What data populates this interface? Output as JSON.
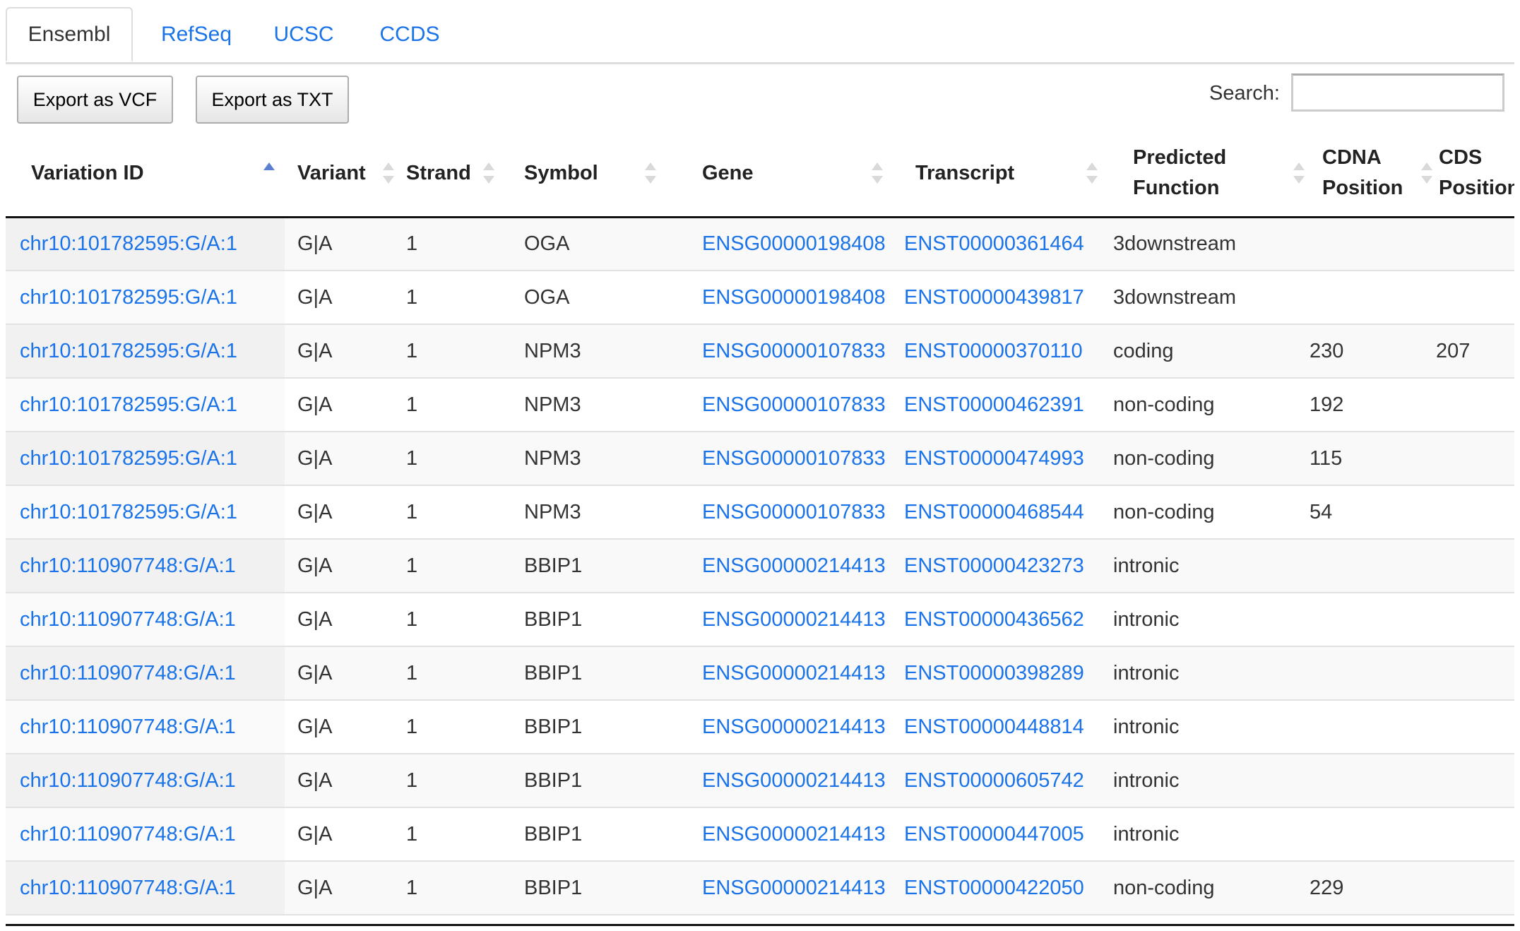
{
  "tabs": [
    {
      "label": "Ensembl",
      "active": true
    },
    {
      "label": "RefSeq",
      "active": false
    },
    {
      "label": "UCSC",
      "active": false
    },
    {
      "label": "CCDS",
      "active": false
    }
  ],
  "toolbar": {
    "export_vcf_label": "Export as VCF",
    "export_txt_label": "Export as TXT",
    "search_label": "Search:",
    "search_value": ""
  },
  "table": {
    "columns": [
      {
        "label": "Variation ID",
        "sort": "asc"
      },
      {
        "label": "Variant",
        "sort": "none"
      },
      {
        "label": "Strand",
        "sort": "none"
      },
      {
        "label": "Symbol",
        "sort": "none"
      },
      {
        "label": "Gene",
        "sort": "none"
      },
      {
        "label": "Transcript",
        "sort": "none"
      },
      {
        "label": "Predicted Function",
        "sort": "none"
      },
      {
        "label": "CDNA Position",
        "sort": "none"
      },
      {
        "label": "CDS Position",
        "sort": "none"
      }
    ],
    "rows": [
      {
        "variation_id": "chr10:101782595:G/A:1",
        "variant": "G|A",
        "strand": "1",
        "symbol": "OGA",
        "gene": "ENSG00000198408",
        "transcript": "ENST00000361464",
        "function": "3downstream",
        "cdna": "",
        "cds": ""
      },
      {
        "variation_id": "chr10:101782595:G/A:1",
        "variant": "G|A",
        "strand": "1",
        "symbol": "OGA",
        "gene": "ENSG00000198408",
        "transcript": "ENST00000439817",
        "function": "3downstream",
        "cdna": "",
        "cds": ""
      },
      {
        "variation_id": "chr10:101782595:G/A:1",
        "variant": "G|A",
        "strand": "1",
        "symbol": "NPM3",
        "gene": "ENSG00000107833",
        "transcript": "ENST00000370110",
        "function": "coding",
        "cdna": "230",
        "cds": "207"
      },
      {
        "variation_id": "chr10:101782595:G/A:1",
        "variant": "G|A",
        "strand": "1",
        "symbol": "NPM3",
        "gene": "ENSG00000107833",
        "transcript": "ENST00000462391",
        "function": "non-coding",
        "cdna": "192",
        "cds": ""
      },
      {
        "variation_id": "chr10:101782595:G/A:1",
        "variant": "G|A",
        "strand": "1",
        "symbol": "NPM3",
        "gene": "ENSG00000107833",
        "transcript": "ENST00000474993",
        "function": "non-coding",
        "cdna": "115",
        "cds": ""
      },
      {
        "variation_id": "chr10:101782595:G/A:1",
        "variant": "G|A",
        "strand": "1",
        "symbol": "NPM3",
        "gene": "ENSG00000107833",
        "transcript": "ENST00000468544",
        "function": "non-coding",
        "cdna": "54",
        "cds": ""
      },
      {
        "variation_id": "chr10:110907748:G/A:1",
        "variant": "G|A",
        "strand": "1",
        "symbol": "BBIP1",
        "gene": "ENSG00000214413",
        "transcript": "ENST00000423273",
        "function": "intronic",
        "cdna": "",
        "cds": ""
      },
      {
        "variation_id": "chr10:110907748:G/A:1",
        "variant": "G|A",
        "strand": "1",
        "symbol": "BBIP1",
        "gene": "ENSG00000214413",
        "transcript": "ENST00000436562",
        "function": "intronic",
        "cdna": "",
        "cds": ""
      },
      {
        "variation_id": "chr10:110907748:G/A:1",
        "variant": "G|A",
        "strand": "1",
        "symbol": "BBIP1",
        "gene": "ENSG00000214413",
        "transcript": "ENST00000398289",
        "function": "intronic",
        "cdna": "",
        "cds": ""
      },
      {
        "variation_id": "chr10:110907748:G/A:1",
        "variant": "G|A",
        "strand": "1",
        "symbol": "BBIP1",
        "gene": "ENSG00000214413",
        "transcript": "ENST00000448814",
        "function": "intronic",
        "cdna": "",
        "cds": ""
      },
      {
        "variation_id": "chr10:110907748:G/A:1",
        "variant": "G|A",
        "strand": "1",
        "symbol": "BBIP1",
        "gene": "ENSG00000214413",
        "transcript": "ENST00000605742",
        "function": "intronic",
        "cdna": "",
        "cds": ""
      },
      {
        "variation_id": "chr10:110907748:G/A:1",
        "variant": "G|A",
        "strand": "1",
        "symbol": "BBIP1",
        "gene": "ENSG00000214413",
        "transcript": "ENST00000447005",
        "function": "intronic",
        "cdna": "",
        "cds": ""
      },
      {
        "variation_id": "chr10:110907748:G/A:1",
        "variant": "G|A",
        "strand": "1",
        "symbol": "BBIP1",
        "gene": "ENSG00000214413",
        "transcript": "ENST00000422050",
        "function": "non-coding",
        "cdna": "229",
        "cds": ""
      }
    ]
  },
  "colors": {
    "link": "#1a73e8",
    "sort_active": "#5b7fd1",
    "row_stripe": "#f9f9f9"
  }
}
